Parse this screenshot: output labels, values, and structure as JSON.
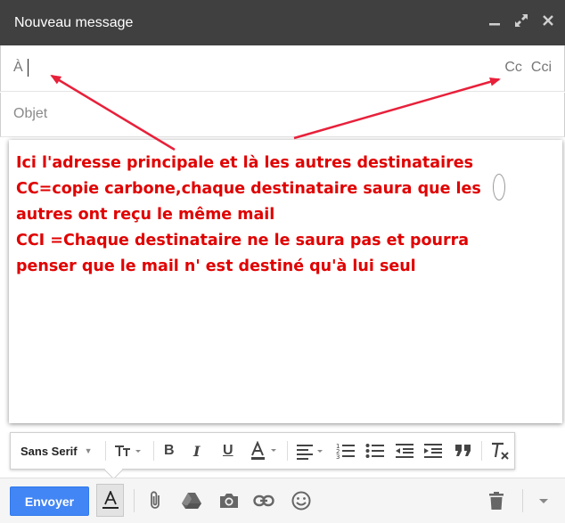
{
  "window": {
    "title": "Nouveau message",
    "controls": [
      "minimize-icon",
      "expand-icon",
      "close-icon"
    ]
  },
  "recipients": {
    "to_label": "À",
    "cc_label": "Cc",
    "bcc_label": "Cci"
  },
  "subject": {
    "placeholder": "Objet",
    "value": ""
  },
  "body": {
    "lines": [
      "Ici l'adresse principale et là les autres destinataires",
      "CC=copie carbone,chaque destinataire saura que   les",
      "autres ont reçu le même mail",
      "CCI =Chaque destinataire ne le saura pas et pourra",
      "penser que le mail n' est destiné qu'à lui seul"
    ],
    "text_color": "#e00000"
  },
  "format_toolbar": {
    "font": "Sans Serif",
    "icons": [
      "font-size-icon",
      "bold-icon",
      "italic-icon",
      "underline-icon",
      "text-color-icon",
      "align-icon",
      "numbered-list-icon",
      "bulleted-list-icon",
      "indent-less-icon",
      "indent-more-icon",
      "quote-icon",
      "remove-formatting-icon"
    ]
  },
  "bottom_bar": {
    "send_label": "Envoyer",
    "icons": [
      "formatting-icon",
      "attach-icon",
      "drive-icon",
      "photo-icon",
      "link-icon",
      "emoji-icon",
      "trash-icon",
      "more-options-icon"
    ]
  },
  "colors": {
    "titlebar": "#404040",
    "send_button": "#4285f4",
    "annotation": "#e00000",
    "arrow": "#e8203a"
  }
}
